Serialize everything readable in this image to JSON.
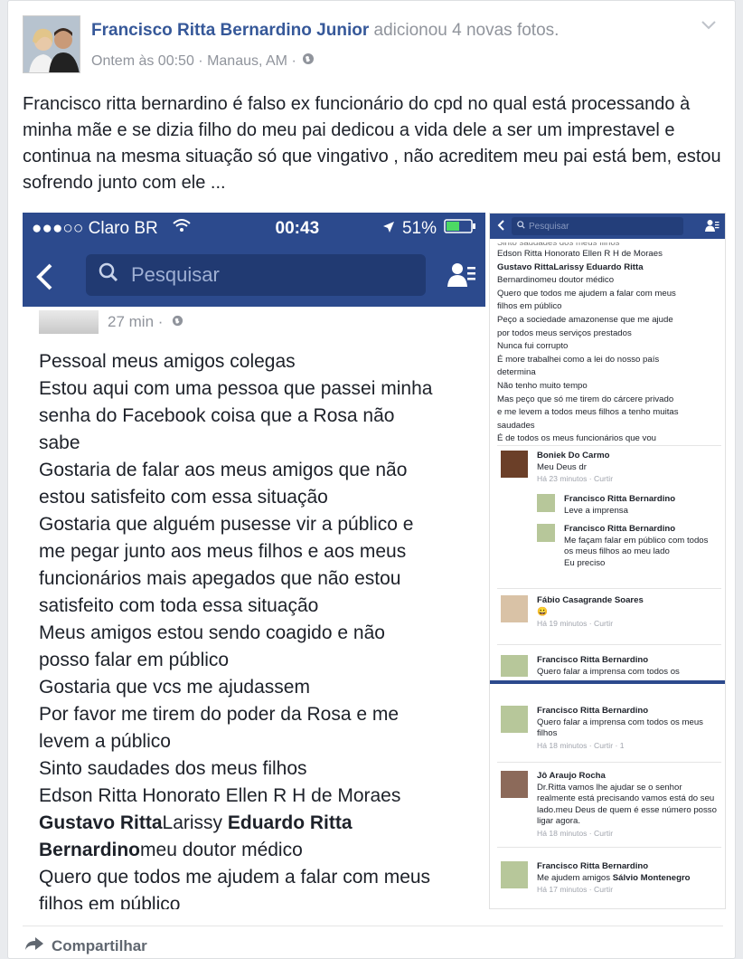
{
  "post": {
    "author": "Francisco Ritta Bernardino Junior",
    "action": "adicionou 4 novas fotos.",
    "timestamp": "Ontem às 00:50 · Manaus, AM ·",
    "status_text": "Francisco ritta bernardino é falso ex funcionário do cpd no qual está processando à minha mãe e se dizia filho do meu pai dedicou a vida dele a ser um imprestavel e continua na mesma situação só que vingativo , não acreditem meu pai está bem, estou sofrendo junto com ele ...",
    "share_label": "Compartilhar"
  },
  "left_photo": {
    "carrier": "●●●○○ Claro BR",
    "time": "00:43",
    "battery": "51%",
    "search_placeholder": "Pesquisar",
    "post_age": "27 min ·",
    "lines": [
      "Pessoal meus amigos colegas",
      "Estou aqui com uma pessoa que passei minha",
      "senha do Facebook coisa que a Rosa não",
      "sabe",
      "Gostaria de falar aos meus amigos  que não",
      "estou satisfeito com essa situação",
      "Gostaria que alguém pusesse vir a público e",
      "me pegar junto aos meus filhos e aos meus",
      "funcionários mais apegados que não estou",
      "satisfeito com toda essa situação",
      "Meus amigos estou sendo coagido e não",
      "posso falar em público",
      "Gostaria que vcs me ajudassem",
      "Por favor me tirem do poder da Rosa e me",
      "levem a público",
      "Sinto saudades dos meus filhos",
      "Edson Ritta Honorato Ellen R H de Moraes"
    ],
    "bold_line_a": "Gustavo Ritta",
    "plain_line_a": "Larissy ",
    "bold_line_b": "Eduardo Ritta",
    "bold_line_c": "Bernardino",
    "plain_line_c": "meu doutor médico",
    "tail_lines": [
      "Quero que todos me ajudem a falar com meus",
      "filhos em público"
    ]
  },
  "right_photo": {
    "search_placeholder": "Pesquisar",
    "top_cut": "Sinto saudades dos meus filhos",
    "lines": [
      "Edson Ritta Honorato Ellen R H de Moraes",
      "Gustavo RittaLarissy Eduardo Ritta",
      "Bernardinomeu doutor médico",
      "Quero que todos me ajudem a falar com meus",
      "filhos em público",
      "Peço a sociedade amazonense que me ajude",
      "por todos meus serviços prestados",
      "Nunca fui corrupto",
      "É more trabalhei como a lei do nosso país",
      "determina",
      "Não tenho muito tempo",
      "Mas peço que só me tirem do cárcere privado",
      "e me levem a todos meus filhos a tenho muitas",
      "saudades",
      "É de todos os meus funcionários que vou"
    ],
    "comments": [
      {
        "name": "Boniek Do Carmo",
        "text": "Meu Deus dr",
        "time": "Há 23 minutos · Curtir"
      },
      {
        "name": "Francisco Ritta Bernardino",
        "text": "Leve a imprensa",
        "time": ""
      },
      {
        "name": "Francisco Ritta Bernardino",
        "text": "Me façam falar em público com todos os meus filhos ao meu lado",
        "text2": "Eu preciso",
        "time": ""
      },
      {
        "name": "Fábio Casagrande Soares",
        "text": "😀",
        "time": "Há 19 minutos · Curtir"
      },
      {
        "name": "Francisco Ritta Bernardino",
        "text": "Quero falar a imprensa com todos os",
        "time": ""
      },
      {
        "name": "Francisco Ritta Bernardino",
        "text": "Quero falar a imprensa com todos os meus filhos",
        "time": "Há 18 minutos · Curtir · 1"
      },
      {
        "name": "Jô Araujo Rocha",
        "text": "Dr.Ritta vamos lhe ajudar se o senhor realmente está precisando vamos está do seu lado.meu Deus de quem é esse número  posso ligar agora.",
        "time": "Há 18 minutos · Curtir"
      },
      {
        "name": "Francisco Ritta Bernardino",
        "text": "Me ajudem amigos ",
        "bold": "Sálvio Montenegro",
        "time": "Há 17 minutos · Curtir"
      }
    ]
  },
  "colors": {
    "fb_blue": "#2c4a8d",
    "link": "#365899",
    "meta": "#90949c"
  }
}
